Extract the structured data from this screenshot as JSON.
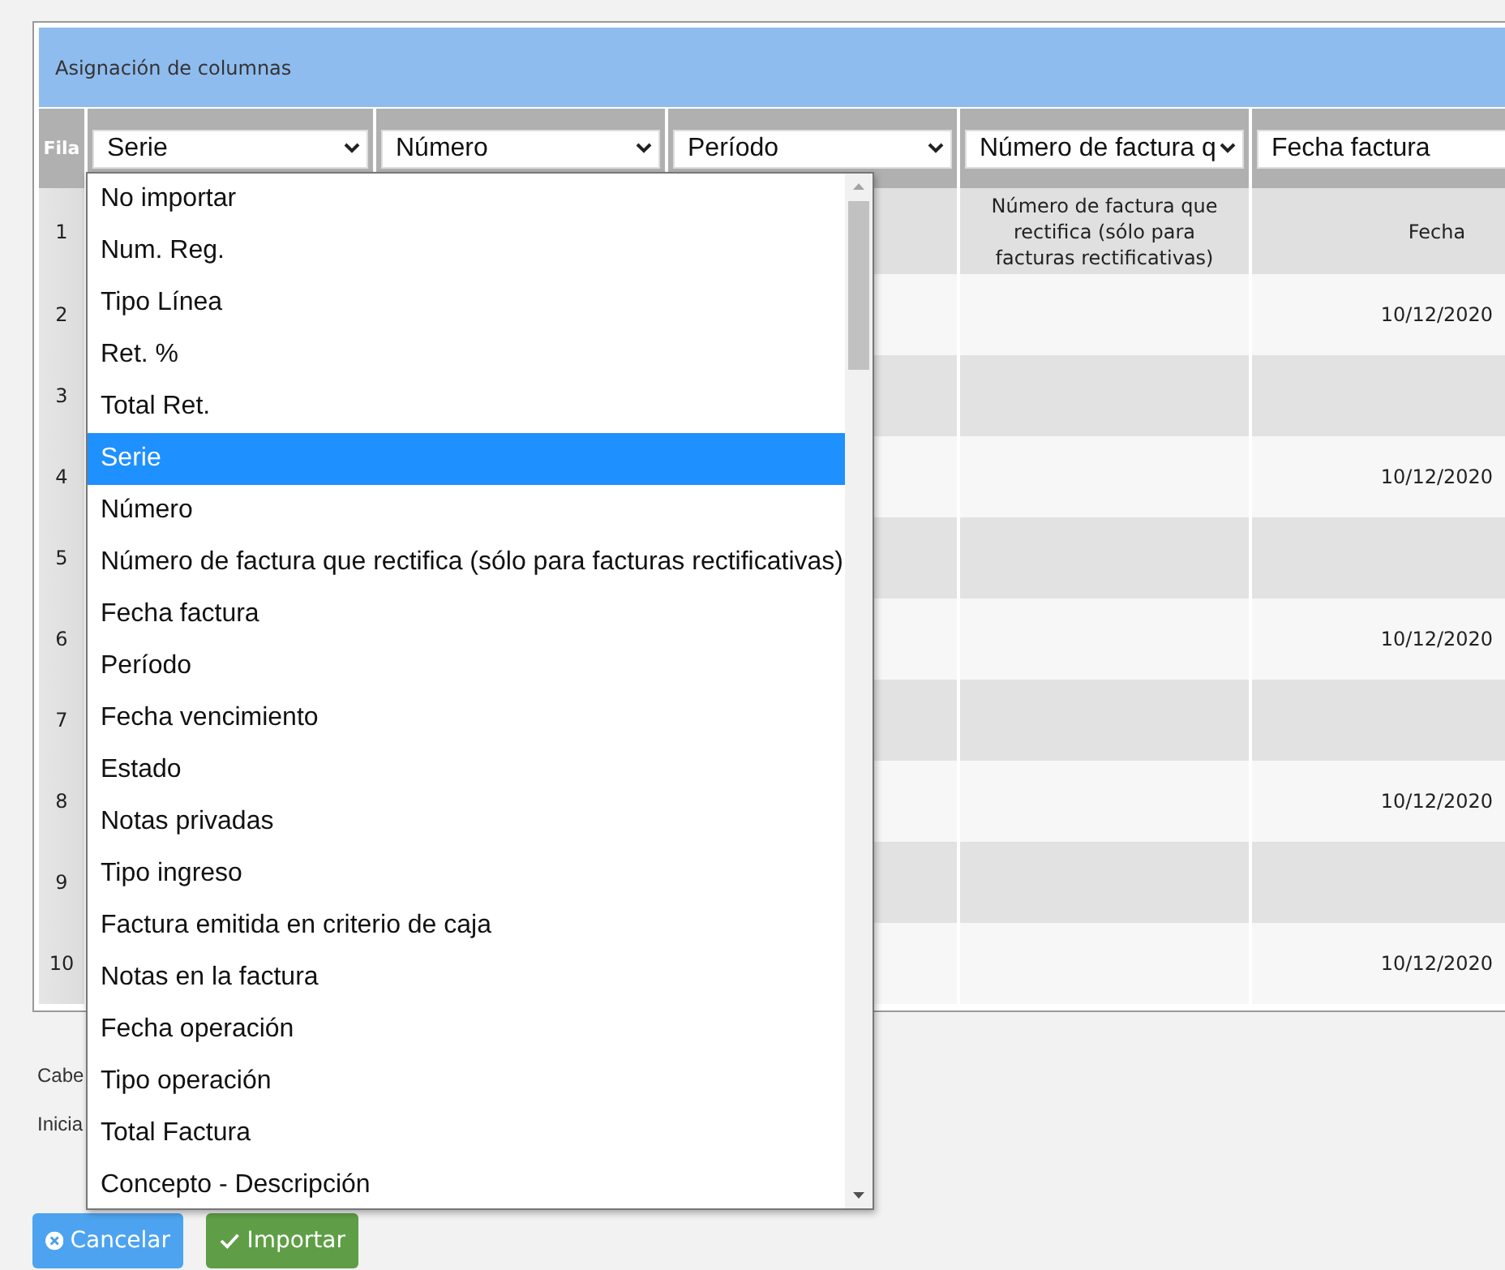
{
  "panel": {
    "title": "Asignación de columnas",
    "row_header": "Fila",
    "column_selects": [
      {
        "value": "Serie"
      },
      {
        "value": "Número"
      },
      {
        "value": "Período"
      },
      {
        "value": "Número de factura q"
      },
      {
        "value": "Fecha factura"
      }
    ],
    "rows": [
      {
        "number": "1",
        "kind": "heading",
        "cells": [
          "Número de factura que rectifica (sólo para facturas rectificativas)",
          "Fecha"
        ]
      },
      {
        "number": "2",
        "kind": "data",
        "cells": [
          "",
          "10/12/2020"
        ]
      },
      {
        "number": "3",
        "kind": "data",
        "cells": [
          "",
          ""
        ]
      },
      {
        "number": "4",
        "kind": "data",
        "cells": [
          "",
          "10/12/2020"
        ]
      },
      {
        "number": "5",
        "kind": "data",
        "cells": [
          "",
          ""
        ]
      },
      {
        "number": "6",
        "kind": "data",
        "cells": [
          "",
          "10/12/2020"
        ]
      },
      {
        "number": "7",
        "kind": "data",
        "cells": [
          "",
          ""
        ]
      },
      {
        "number": "8",
        "kind": "data",
        "cells": [
          "",
          "10/12/2020"
        ]
      },
      {
        "number": "9",
        "kind": "data",
        "cells": [
          "",
          ""
        ]
      },
      {
        "number": "10",
        "kind": "data",
        "cells": [
          "",
          "10/12/2020"
        ]
      }
    ]
  },
  "labels": [
    "Cabe",
    "Inicia"
  ],
  "buttons": [
    {
      "kind": "cancel",
      "label": "Cancelar"
    },
    {
      "kind": "import",
      "label": "Importar"
    }
  ],
  "dropdown": {
    "options": [
      {
        "label": "No importar",
        "selected": false
      },
      {
        "label": "Num. Reg.",
        "selected": false
      },
      {
        "label": "Tipo Línea",
        "selected": false
      },
      {
        "label": "Ret. %",
        "selected": false
      },
      {
        "label": "Total Ret.",
        "selected": false
      },
      {
        "label": "Serie",
        "selected": true
      },
      {
        "label": "Número",
        "selected": false
      },
      {
        "label": "Número de factura que rectifica (sólo para facturas rectificativas)",
        "selected": false
      },
      {
        "label": "Fecha factura",
        "selected": false
      },
      {
        "label": "Período",
        "selected": false
      },
      {
        "label": "Fecha vencimiento",
        "selected": false
      },
      {
        "label": "Estado",
        "selected": false
      },
      {
        "label": "Notas privadas",
        "selected": false
      },
      {
        "label": "Tipo ingreso",
        "selected": false
      },
      {
        "label": "Factura emitida en criterio de caja",
        "selected": false
      },
      {
        "label": "Notas en la factura",
        "selected": false
      },
      {
        "label": "Fecha operación",
        "selected": false
      },
      {
        "label": "Tipo operación",
        "selected": false
      },
      {
        "label": "Total Factura",
        "selected": false
      },
      {
        "label": "Concepto - Descripción",
        "selected": false
      }
    ]
  }
}
